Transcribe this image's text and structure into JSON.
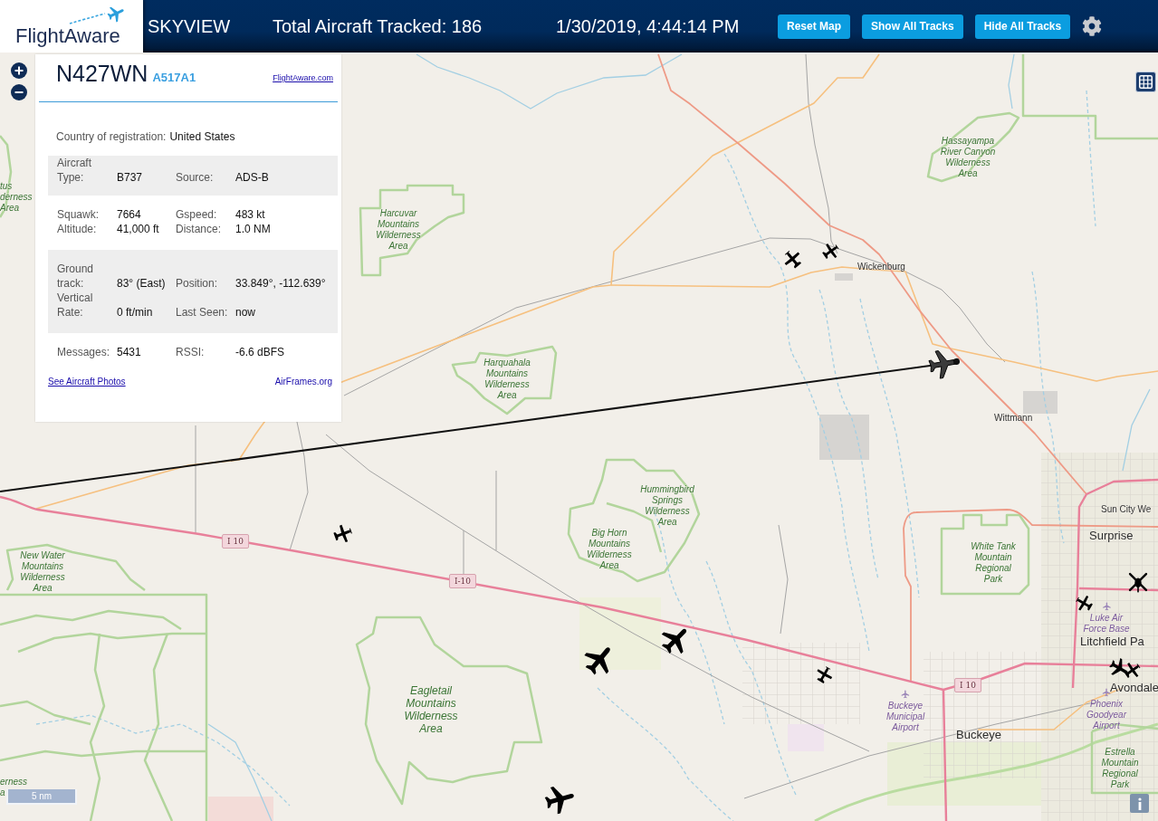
{
  "header": {
    "logo": "FlightAware",
    "title": "SKYVIEW",
    "total": "Total Aircraft Tracked: 186",
    "time": "1/30/2019, 4:44:14 PM",
    "buttons": [
      "Reset Map",
      "Show All Tracks",
      "Hide All Tracks"
    ]
  },
  "info_panel": {
    "callsign": "N427WN",
    "hex": "A517A1",
    "link": "FlightAware.com",
    "country_label": "Country of registration:",
    "country": "United States",
    "groups": [
      {
        "rows": [
          [
            {
              "label": "Aircraft Type:",
              "value": "B737"
            },
            {
              "label": "Source:",
              "value": "ADS-B"
            }
          ]
        ]
      },
      {
        "rows": [
          [
            {
              "label": "Squawk:",
              "value": "7664"
            },
            {
              "label": "Gspeed:",
              "value": "483 kt"
            }
          ],
          [
            {
              "label": "Altitude:",
              "value": "41,000 ft"
            },
            {
              "label": "Distance:",
              "value": "1.0 NM"
            }
          ]
        ]
      },
      {
        "rows": [
          [
            {
              "label": "Ground track:",
              "value": "83° (East)"
            },
            {
              "label": "Position:",
              "value": "33.849°, -112.639°"
            }
          ],
          [
            {
              "label": "Vertical Rate:",
              "value": "0 ft/min"
            },
            {
              "label": "Last Seen:",
              "value": "now"
            }
          ]
        ]
      },
      {
        "rows": [
          [
            {
              "label": "Messages:",
              "value": "5431"
            },
            {
              "label": "RSSI:",
              "value": "-6.6 dBFS"
            }
          ]
        ]
      }
    ],
    "links": [
      "See Aircraft Photos",
      "AirFrames.org"
    ]
  },
  "map_labels": [
    {
      "kind": "park",
      "lines": [
        "Hassayampa",
        "River Canyon",
        "Wilderness",
        "Area"
      ]
    },
    {
      "kind": "park",
      "lines": [
        "tus",
        "derness",
        "Area"
      ]
    },
    {
      "kind": "park",
      "lines": [
        "Harcuvar",
        "Mountains",
        "Wilderness",
        "Area"
      ]
    },
    {
      "kind": "town",
      "lines": [
        "Wickenburg"
      ]
    },
    {
      "kind": "park",
      "lines": [
        "Harquahala",
        "Mountains",
        "Wilderness",
        "Area"
      ]
    },
    {
      "kind": "town",
      "lines": [
        "Wittmann"
      ]
    },
    {
      "kind": "park",
      "lines": [
        "Hummingbird",
        "Springs",
        "Wilderness",
        "Area"
      ]
    },
    {
      "kind": "town",
      "lines": [
        "Sun City We"
      ]
    },
    {
      "kind": "park",
      "lines": [
        "New Water",
        "Mountains",
        "Wilderness",
        "Area"
      ]
    },
    {
      "kind": "shield",
      "lines": [
        "I 10"
      ]
    },
    {
      "kind": "shield",
      "lines": [
        "I-10"
      ]
    },
    {
      "kind": "park",
      "lines": [
        "Big Horn",
        "Mountains",
        "Wilderness",
        "Area"
      ]
    },
    {
      "kind": "park",
      "lines": [
        "White Tank",
        "Mountain",
        "Regional",
        "Park"
      ]
    },
    {
      "kind": "city",
      "lines": [
        "Surprise"
      ]
    },
    {
      "kind": "airport",
      "lines": [
        "Luke Air",
        "Force Base"
      ]
    },
    {
      "kind": "city",
      "lines": [
        "Litchfield Pa"
      ]
    },
    {
      "kind": "park",
      "lines": [
        "Eagletail",
        "Mountains",
        "Wilderness",
        "Area"
      ]
    },
    {
      "kind": "airport",
      "lines": [
        "Buckeye",
        "Municipal",
        "Airport"
      ]
    },
    {
      "kind": "shield",
      "lines": [
        "I 10"
      ]
    },
    {
      "kind": "city",
      "lines": [
        "Buckeye"
      ]
    },
    {
      "kind": "airport",
      "lines": [
        "Phoenix",
        "Goodyear",
        "Airport"
      ]
    },
    {
      "kind": "city",
      "lines": [
        "Avondale"
      ]
    },
    {
      "kind": "park",
      "lines": [
        "erness",
        "a"
      ]
    },
    {
      "kind": "park",
      "lines": [
        "Estrella",
        "Mountain",
        "Regional",
        "Park"
      ]
    }
  ],
  "aircraft": [
    {
      "kind": "prop",
      "selected": false
    },
    {
      "kind": "prop",
      "selected": false
    },
    {
      "kind": "jet",
      "selected": true
    },
    {
      "kind": "prop",
      "selected": false
    },
    {
      "kind": "helicopter",
      "selected": false
    },
    {
      "kind": "prop",
      "selected": false
    },
    {
      "kind": "jet",
      "selected": false
    },
    {
      "kind": "jet",
      "selected": false
    },
    {
      "kind": "prop",
      "selected": false
    },
    {
      "kind": "jet",
      "selected": false
    },
    {
      "kind": "prop",
      "selected": false
    },
    {
      "kind": "jet",
      "selected": false
    }
  ],
  "scale": "5 nm"
}
